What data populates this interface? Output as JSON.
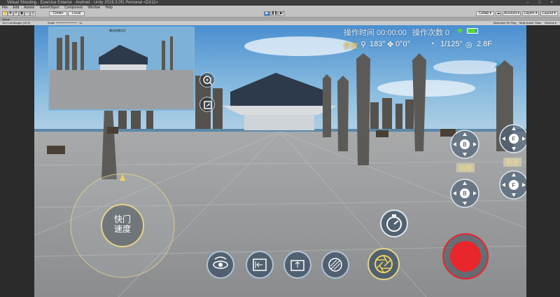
{
  "window": {
    "title": "Virtual Shooting - Exercise Exterior - Android - Unity 2019.3.0f1 Personal <DX11>",
    "controls": "–  □  ×"
  },
  "menu": [
    "File",
    "Edit",
    "Assets",
    "GameObject",
    "Component",
    "Window",
    "Help"
  ],
  "toolbar": {
    "center_label": "Center",
    "local_label": "Local",
    "collab_label": "Collab ▾",
    "account_label": "Account ▾",
    "layers_label": "Layers ▾",
    "layout_label": "Layout ▾"
  },
  "game_view": {
    "tab_label": "Game",
    "resolution": "16:9 Landscape (16:9)",
    "scale_label": "Scale",
    "scale_value": "1x",
    "options": [
      "Maximize On Play",
      "Mute Audio",
      "Stats",
      "Gizmos ▾"
    ]
  },
  "hud": {
    "operation_time_label": "操作时间 00:00:00",
    "operation_count_label": "操作次数 0",
    "params_label": "参数",
    "heading_value": "183°",
    "tilt_value": "0°0°",
    "shutter_value": "1/125\"",
    "aperture_value": "2.8F",
    "pip_caption": "最佳拍摄点位",
    "backward_label": "后退",
    "forward_label": "前进",
    "shutter_speed_label_line1": "快门",
    "shutter_speed_label_line2": "速度",
    "btn_letters": {
      "b": "B",
      "f": "F"
    }
  },
  "colors": {
    "record_red": "#e8262b",
    "hud_yellow": "#f0d25a",
    "battery_green": "#59d63a"
  }
}
